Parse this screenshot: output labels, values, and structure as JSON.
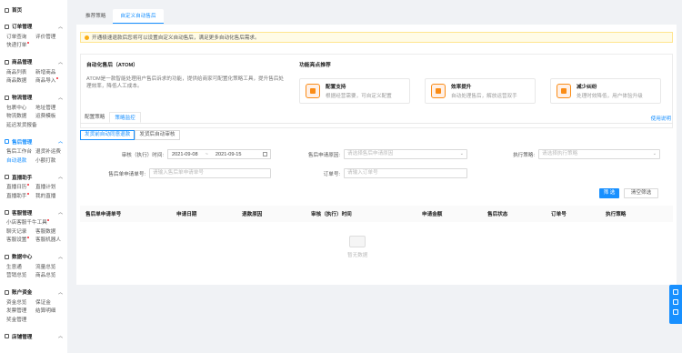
{
  "sidebar": {
    "home": "首页",
    "sections": [
      {
        "title": "订单管理",
        "active": false,
        "rows": [
          [
            {
              "t": "订单查询"
            },
            {
              "t": "评价管理"
            }
          ],
          [
            {
              "t": "快递打单",
              "dot": true
            }
          ]
        ]
      },
      {
        "title": "商品管理",
        "active": false,
        "rows": [
          [
            {
              "t": "商品列表"
            },
            {
              "t": "新增商品"
            }
          ],
          [
            {
              "t": "商品数据"
            },
            {
              "t": "商品导入",
              "dot": true
            }
          ]
        ]
      },
      {
        "title": "物流管理",
        "active": false,
        "rows": [
          [
            {
              "t": "包裹中心"
            },
            {
              "t": "地址管理"
            }
          ],
          [
            {
              "t": "物流数据"
            },
            {
              "t": "运费模板"
            }
          ],
          [
            {
              "t": "延迟发货报备"
            }
          ]
        ]
      },
      {
        "title": "售后管理",
        "active": true,
        "rows": [
          [
            {
              "t": "售后工作台"
            },
            {
              "t": "退货补运费"
            }
          ],
          [
            {
              "t": "自动退款",
              "active": true
            },
            {
              "t": "小额打款"
            }
          ]
        ]
      },
      {
        "title": "直播助手",
        "active": false,
        "rows": [
          [
            {
              "t": "直播日历",
              "dot": true
            },
            {
              "t": "直播计划"
            }
          ],
          [
            {
              "t": "直播助手",
              "dot": true
            },
            {
              "t": "我的直播"
            }
          ]
        ]
      },
      {
        "title": "客服管理",
        "active": false,
        "rows": [
          [
            {
              "t": "小店客服千牛工具",
              "dot": true
            }
          ],
          [
            {
              "t": "聊天记录"
            },
            {
              "t": "客服数据"
            }
          ],
          [
            {
              "t": "客服设置",
              "dot": true
            },
            {
              "t": "客服机器人"
            }
          ]
        ]
      },
      {
        "title": "数据中心",
        "active": false,
        "rows": [
          [
            {
              "t": "生意通"
            },
            {
              "t": "流量总览"
            }
          ],
          [
            {
              "t": "营销总览"
            },
            {
              "t": "商品总览"
            }
          ]
        ]
      },
      {
        "title": "账户资金",
        "active": false,
        "rows": [
          [
            {
              "t": "资金总览"
            },
            {
              "t": "保证金"
            }
          ],
          [
            {
              "t": "发票管理"
            },
            {
              "t": "结算明细"
            }
          ],
          [
            {
              "t": "奖金管理"
            }
          ]
        ]
      },
      {
        "title": "店铺管理",
        "active": false,
        "rows": []
      }
    ]
  },
  "topbar": {
    "tab1": "推荐策略",
    "tab2": "自定义自动售后"
  },
  "notice": "开通极速退款后您将可以设置自定义自动售后，满足更多自动化售后需求。",
  "atom": {
    "title": "自动化售后（ATOM）",
    "desc": "ATOM是一款智能处理用户售后诉求的功能，提供给商家可配置化策略工具，提升售后处理效率，降低人工成本。",
    "rec_title": "功能亮点推荐",
    "cards": [
      {
        "title": "配置支持",
        "desc": "根据经营需要，可自定义配置"
      },
      {
        "title": "效率提升",
        "desc": "自动处理售后，解放运营双手"
      },
      {
        "title": "减少纠纷",
        "desc": "处理时效降低，用户体验升级"
      }
    ]
  },
  "subtabs": {
    "config": "配置策略",
    "monitor": "策略监控"
  },
  "help": "使用说明",
  "btntabs": {
    "refund": "发货前自动同意退款",
    "audit": "发货后自动审核"
  },
  "filters": {
    "time_label": "审核（执行）时间:",
    "date_start": "2021-09-08",
    "date_sep": "~",
    "date_end": "2021-09-15",
    "reason_label": "售后申请原因:",
    "reason_placeholder": "请选择售后申请原因",
    "strategy_label": "执行策略:",
    "strategy_placeholder": "请选择执行策略",
    "aftersale_no_label": "售后单申请单号:",
    "aftersale_no_placeholder": "请输入售后单申请单号",
    "order_no_label": "订单号:",
    "order_no_placeholder": "请输入订单号",
    "filter_btn": "筛 选",
    "clear_btn": "清空筛选"
  },
  "table": {
    "headers": [
      "售后单申请单号",
      "申请日期",
      "退款原因",
      "审核（执行）时间",
      "申请金额",
      "售后状态",
      "订单号",
      "执行策略"
    ],
    "empty": "暂无数据"
  },
  "colors": {
    "primary": "#1890ff",
    "warning": "#faad14",
    "accent": "#fa8c16"
  }
}
